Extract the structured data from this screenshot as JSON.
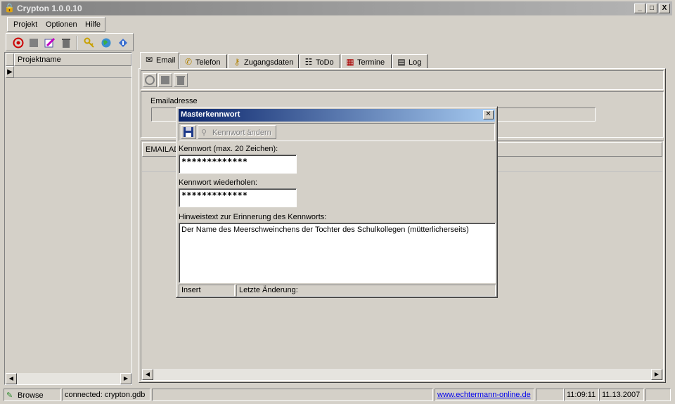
{
  "window": {
    "title": "Crypton 1.0.0.10",
    "min_label": "_",
    "max_label": "□",
    "close_label": "X"
  },
  "menu": {
    "items": [
      {
        "label": "Projekt"
      },
      {
        "label": "Optionen"
      },
      {
        "label": "Hilfe"
      }
    ]
  },
  "toolbar": {
    "icons": [
      "new-record-icon",
      "disabled-icon",
      "edit-icon",
      "delete-icon",
      "keys-icon",
      "globe-icon",
      "info-icon"
    ]
  },
  "project_grid": {
    "header": "Projektname",
    "row_indicator": "▶"
  },
  "tabs": [
    {
      "label": "Email",
      "icon": "envelope-icon",
      "active": true
    },
    {
      "label": "Telefon",
      "icon": "phone-icon",
      "active": false
    },
    {
      "label": "Zugangsdaten",
      "icon": "key-icon",
      "active": false
    },
    {
      "label": "ToDo",
      "icon": "checklist-icon",
      "active": false
    },
    {
      "label": "Termine",
      "icon": "calendar-icon",
      "active": false
    },
    {
      "label": "Log",
      "icon": "log-icon",
      "active": false
    }
  ],
  "email_tab": {
    "field_label": "Emailadresse",
    "field_value": "",
    "grid_header": "EMAILADR"
  },
  "dialog": {
    "title": "Masterkennwort",
    "close_label": "✕",
    "change_password_label": "Kennwort ändern",
    "password_label": "Kennwort (max. 20 Zeichen):",
    "password_value": "*************",
    "repeat_label": "Kennwort wiederholen:",
    "repeat_value": "*************",
    "hint_label": "Hinweistext zur Erinnerung des Kennworts:",
    "hint_value": "Der Name des Meerschweinchens der Tochter des Schulkollegen (mütterlicherseits)",
    "status_mode": "Insert",
    "status_last_change": "Letzte Änderung:"
  },
  "statusbar": {
    "mode": "Browse",
    "connection": "connected: crypton.gdb",
    "link": "www.echtermann-online.de",
    "time": "11:09:11",
    "date": "11.13.2007"
  },
  "colors": {
    "face": "#d4d0c8",
    "dialog_title_start": "#0a246a",
    "dialog_title_end": "#a6caf0",
    "link": "#0000ee"
  }
}
